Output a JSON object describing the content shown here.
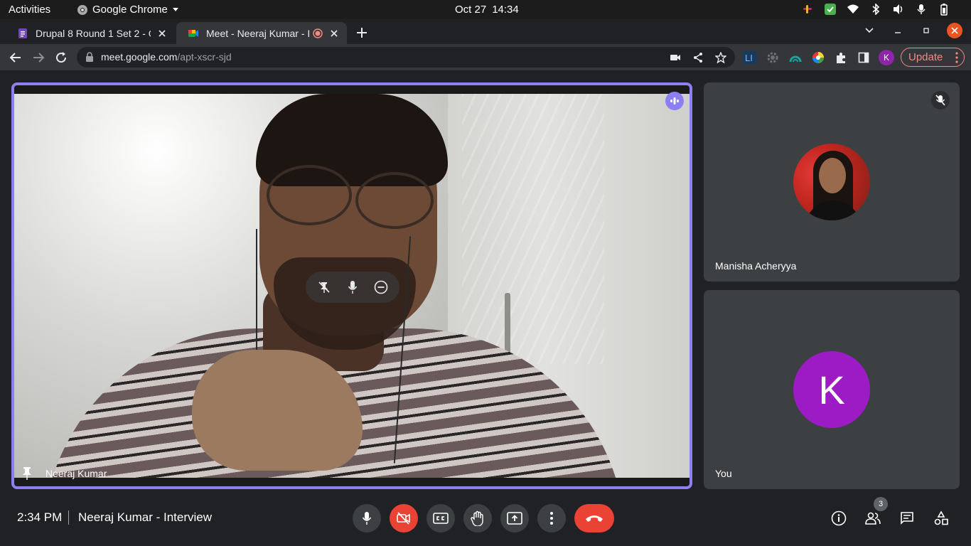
{
  "os_bar": {
    "activities": "Activities",
    "app_name": "Google Chrome",
    "date": "Oct 27",
    "time": "14:34"
  },
  "browser": {
    "tabs": [
      {
        "title": "Drupal 8 Round 1 Set 2 - G",
        "icon": "docs-icon"
      },
      {
        "title": "Meet - Neeraj Kumar - I",
        "icon": "meet-icon",
        "recording": true
      }
    ],
    "url_host": "meet.google.com",
    "url_path": "/apt-xscr-sjd",
    "profile_initial": "K",
    "update_label": "Update",
    "extension_label": "LI"
  },
  "meet": {
    "main_participant": "Neeraj Kumar",
    "participants": [
      {
        "name": "Manisha Acheryya",
        "muted": true
      },
      {
        "name": "You",
        "initial": "K"
      }
    ],
    "clock": "2:34 PM",
    "meeting_title": "Neeraj Kumar - Interview",
    "people_count": "3"
  },
  "colors": {
    "accent_border": "#8c7ff3",
    "hangup": "#ea4335",
    "avatar_you": "#9c1bc4",
    "update_text": "#f28b82"
  }
}
